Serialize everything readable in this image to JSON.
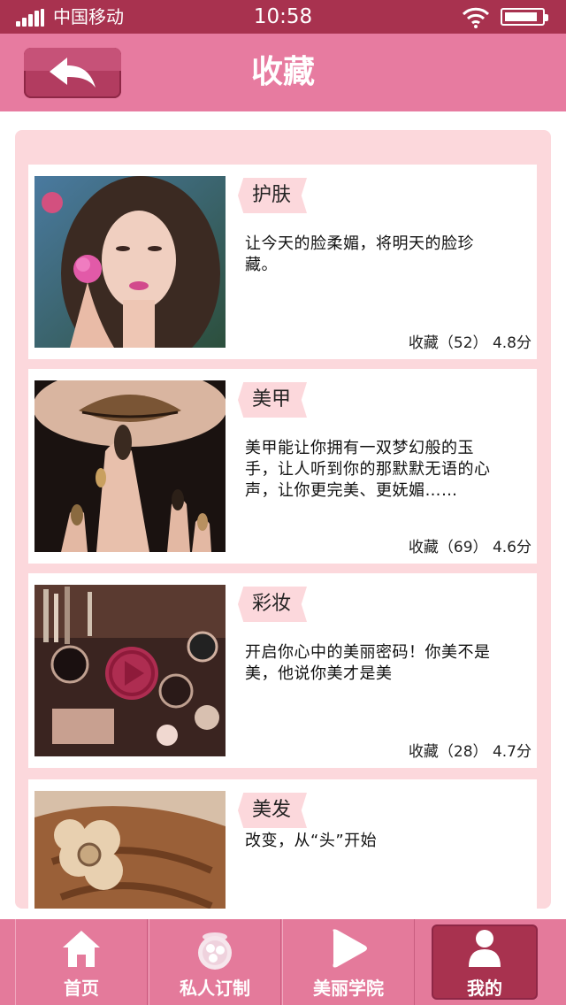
{
  "status_bar": {
    "carrier": "中国移动",
    "time": "10:58"
  },
  "nav": {
    "title": "收藏",
    "back_icon": "back-arrow-icon"
  },
  "favorites": [
    {
      "category": "护肤",
      "description": "让今天的脸柔媚，将明天的脸珍藏。",
      "stats": "收藏（52） 4.8分",
      "image": "woman-portrait-with-rose"
    },
    {
      "category": "美甲",
      "description": "美甲能让你拥有一双梦幻般的玉手，让人听到你的那默默无语的心声，让你更完美、更妩媚……",
      "stats": "收藏（69） 4.6分",
      "image": "lips-and-nails"
    },
    {
      "category": "彩妆",
      "description": "开启你心中的美丽密码！你美不是美，他说你美才是美",
      "stats": "收藏（28） 4.7分",
      "image": "makeup-products-with-play-button"
    },
    {
      "category": "美发",
      "description": "改变，从“头”开始",
      "stats": "",
      "image": "braided-hair-with-flower-clip"
    }
  ],
  "tabbar": {
    "tabs": [
      {
        "label": "首页",
        "icon": "home-icon"
      },
      {
        "label": "私人订制",
        "icon": "compact-powder-icon"
      },
      {
        "label": "美丽学院",
        "icon": "play-icon"
      },
      {
        "label": "我的",
        "icon": "user-icon"
      }
    ],
    "active_index": 3
  },
  "colors": {
    "status_bar": "#a8324f",
    "nav_bar": "#e77ba0",
    "panel": "#fcd8dc",
    "tab_active": "#a8324f"
  }
}
